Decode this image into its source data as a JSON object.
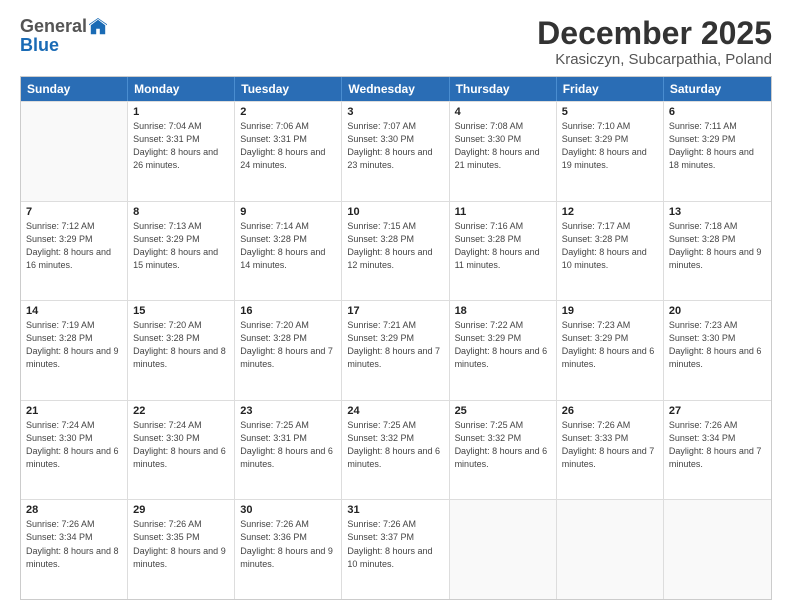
{
  "logo": {
    "general": "General",
    "blue": "Blue"
  },
  "title": "December 2025",
  "subtitle": "Krasiczyn, Subcarpathia, Poland",
  "days": [
    "Sunday",
    "Monday",
    "Tuesday",
    "Wednesday",
    "Thursday",
    "Friday",
    "Saturday"
  ],
  "weeks": [
    [
      {
        "day": "",
        "sunrise": "",
        "sunset": "",
        "daylight": ""
      },
      {
        "day": "1",
        "sunrise": "Sunrise: 7:04 AM",
        "sunset": "Sunset: 3:31 PM",
        "daylight": "Daylight: 8 hours and 26 minutes."
      },
      {
        "day": "2",
        "sunrise": "Sunrise: 7:06 AM",
        "sunset": "Sunset: 3:31 PM",
        "daylight": "Daylight: 8 hours and 24 minutes."
      },
      {
        "day": "3",
        "sunrise": "Sunrise: 7:07 AM",
        "sunset": "Sunset: 3:30 PM",
        "daylight": "Daylight: 8 hours and 23 minutes."
      },
      {
        "day": "4",
        "sunrise": "Sunrise: 7:08 AM",
        "sunset": "Sunset: 3:30 PM",
        "daylight": "Daylight: 8 hours and 21 minutes."
      },
      {
        "day": "5",
        "sunrise": "Sunrise: 7:10 AM",
        "sunset": "Sunset: 3:29 PM",
        "daylight": "Daylight: 8 hours and 19 minutes."
      },
      {
        "day": "6",
        "sunrise": "Sunrise: 7:11 AM",
        "sunset": "Sunset: 3:29 PM",
        "daylight": "Daylight: 8 hours and 18 minutes."
      }
    ],
    [
      {
        "day": "7",
        "sunrise": "Sunrise: 7:12 AM",
        "sunset": "Sunset: 3:29 PM",
        "daylight": "Daylight: 8 hours and 16 minutes."
      },
      {
        "day": "8",
        "sunrise": "Sunrise: 7:13 AM",
        "sunset": "Sunset: 3:29 PM",
        "daylight": "Daylight: 8 hours and 15 minutes."
      },
      {
        "day": "9",
        "sunrise": "Sunrise: 7:14 AM",
        "sunset": "Sunset: 3:28 PM",
        "daylight": "Daylight: 8 hours and 14 minutes."
      },
      {
        "day": "10",
        "sunrise": "Sunrise: 7:15 AM",
        "sunset": "Sunset: 3:28 PM",
        "daylight": "Daylight: 8 hours and 12 minutes."
      },
      {
        "day": "11",
        "sunrise": "Sunrise: 7:16 AM",
        "sunset": "Sunset: 3:28 PM",
        "daylight": "Daylight: 8 hours and 11 minutes."
      },
      {
        "day": "12",
        "sunrise": "Sunrise: 7:17 AM",
        "sunset": "Sunset: 3:28 PM",
        "daylight": "Daylight: 8 hours and 10 minutes."
      },
      {
        "day": "13",
        "sunrise": "Sunrise: 7:18 AM",
        "sunset": "Sunset: 3:28 PM",
        "daylight": "Daylight: 8 hours and 9 minutes."
      }
    ],
    [
      {
        "day": "14",
        "sunrise": "Sunrise: 7:19 AM",
        "sunset": "Sunset: 3:28 PM",
        "daylight": "Daylight: 8 hours and 9 minutes."
      },
      {
        "day": "15",
        "sunrise": "Sunrise: 7:20 AM",
        "sunset": "Sunset: 3:28 PM",
        "daylight": "Daylight: 8 hours and 8 minutes."
      },
      {
        "day": "16",
        "sunrise": "Sunrise: 7:20 AM",
        "sunset": "Sunset: 3:28 PM",
        "daylight": "Daylight: 8 hours and 7 minutes."
      },
      {
        "day": "17",
        "sunrise": "Sunrise: 7:21 AM",
        "sunset": "Sunset: 3:29 PM",
        "daylight": "Daylight: 8 hours and 7 minutes."
      },
      {
        "day": "18",
        "sunrise": "Sunrise: 7:22 AM",
        "sunset": "Sunset: 3:29 PM",
        "daylight": "Daylight: 8 hours and 6 minutes."
      },
      {
        "day": "19",
        "sunrise": "Sunrise: 7:23 AM",
        "sunset": "Sunset: 3:29 PM",
        "daylight": "Daylight: 8 hours and 6 minutes."
      },
      {
        "day": "20",
        "sunrise": "Sunrise: 7:23 AM",
        "sunset": "Sunset: 3:30 PM",
        "daylight": "Daylight: 8 hours and 6 minutes."
      }
    ],
    [
      {
        "day": "21",
        "sunrise": "Sunrise: 7:24 AM",
        "sunset": "Sunset: 3:30 PM",
        "daylight": "Daylight: 8 hours and 6 minutes."
      },
      {
        "day": "22",
        "sunrise": "Sunrise: 7:24 AM",
        "sunset": "Sunset: 3:30 PM",
        "daylight": "Daylight: 8 hours and 6 minutes."
      },
      {
        "day": "23",
        "sunrise": "Sunrise: 7:25 AM",
        "sunset": "Sunset: 3:31 PM",
        "daylight": "Daylight: 8 hours and 6 minutes."
      },
      {
        "day": "24",
        "sunrise": "Sunrise: 7:25 AM",
        "sunset": "Sunset: 3:32 PM",
        "daylight": "Daylight: 8 hours and 6 minutes."
      },
      {
        "day": "25",
        "sunrise": "Sunrise: 7:25 AM",
        "sunset": "Sunset: 3:32 PM",
        "daylight": "Daylight: 8 hours and 6 minutes."
      },
      {
        "day": "26",
        "sunrise": "Sunrise: 7:26 AM",
        "sunset": "Sunset: 3:33 PM",
        "daylight": "Daylight: 8 hours and 7 minutes."
      },
      {
        "day": "27",
        "sunrise": "Sunrise: 7:26 AM",
        "sunset": "Sunset: 3:34 PM",
        "daylight": "Daylight: 8 hours and 7 minutes."
      }
    ],
    [
      {
        "day": "28",
        "sunrise": "Sunrise: 7:26 AM",
        "sunset": "Sunset: 3:34 PM",
        "daylight": "Daylight: 8 hours and 8 minutes."
      },
      {
        "day": "29",
        "sunrise": "Sunrise: 7:26 AM",
        "sunset": "Sunset: 3:35 PM",
        "daylight": "Daylight: 8 hours and 9 minutes."
      },
      {
        "day": "30",
        "sunrise": "Sunrise: 7:26 AM",
        "sunset": "Sunset: 3:36 PM",
        "daylight": "Daylight: 8 hours and 9 minutes."
      },
      {
        "day": "31",
        "sunrise": "Sunrise: 7:26 AM",
        "sunset": "Sunset: 3:37 PM",
        "daylight": "Daylight: 8 hours and 10 minutes."
      },
      {
        "day": "",
        "sunrise": "",
        "sunset": "",
        "daylight": ""
      },
      {
        "day": "",
        "sunrise": "",
        "sunset": "",
        "daylight": ""
      },
      {
        "day": "",
        "sunrise": "",
        "sunset": "",
        "daylight": ""
      }
    ]
  ]
}
